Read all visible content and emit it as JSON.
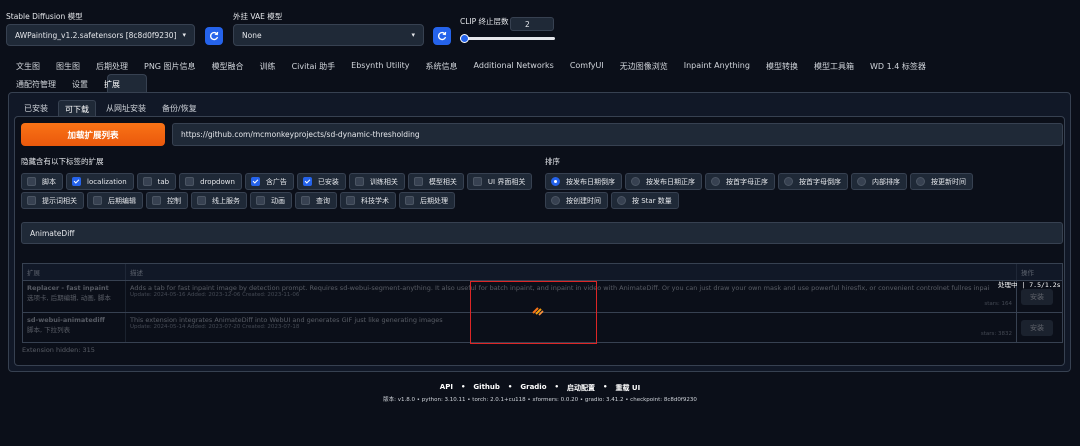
{
  "model": {
    "label": "Stable Diffusion 模型",
    "value": "AWPainting_v1.2.safetensors [8c8d0f9230]"
  },
  "vae": {
    "label": "外挂 VAE 模型",
    "value": "None"
  },
  "clip": {
    "label": "CLIP 终止层数",
    "value": "2",
    "slider_fraction": 0.05
  },
  "nav": {
    "row1": [
      "文生图",
      "图生图",
      "后期处理",
      "PNG 图片信息",
      "模型融合",
      "训练",
      "Civitai 助手",
      "Ebsynth Utility",
      "系统信息",
      "Additional Networks",
      "ComfyUI",
      "无边图像浏览",
      "Inpaint Anything",
      "模型转换",
      "模型工具箱",
      "WD 1.4 标签器"
    ],
    "row2": [
      "通配符管理",
      "设置",
      "扩展"
    ],
    "active": "扩展"
  },
  "subtabs": [
    "已安装",
    "可下载",
    "从网址安装",
    "备份/恢复"
  ],
  "subtab_active": "可下载",
  "load_button": "加载扩展列表",
  "index_url": "https://github.com/mcmonkeyprojects/sd-dynamic-thresholding",
  "hide_label": "隐藏含有以下标签的扩展",
  "tags": [
    {
      "label": "脚本",
      "checked": false
    },
    {
      "label": "localization",
      "checked": true
    },
    {
      "label": "tab",
      "checked": false
    },
    {
      "label": "dropdown",
      "checked": false
    },
    {
      "label": "含广告",
      "checked": true
    },
    {
      "label": "已安装",
      "checked": true
    },
    {
      "label": "训练相关",
      "checked": false
    },
    {
      "label": "模型相关",
      "checked": false
    },
    {
      "label": "UI 界面相关",
      "checked": false
    },
    {
      "label": "提示词相关",
      "checked": false
    },
    {
      "label": "后期编辑",
      "checked": false
    },
    {
      "label": "控制",
      "checked": false
    },
    {
      "label": "线上服务",
      "checked": false
    },
    {
      "label": "动画",
      "checked": false
    },
    {
      "label": "查询",
      "checked": false
    },
    {
      "label": "科技学术",
      "checked": false
    },
    {
      "label": "后期处理",
      "checked": false
    }
  ],
  "sort_label": "排序",
  "sort_options": [
    {
      "label": "按发布日期倒序",
      "checked": true
    },
    {
      "label": "按发布日期正序",
      "checked": false
    },
    {
      "label": "按首字母正序",
      "checked": false
    },
    {
      "label": "按首字母倒序",
      "checked": false
    },
    {
      "label": "内部排序",
      "checked": false
    },
    {
      "label": "按更新时间",
      "checked": false
    },
    {
      "label": "按创建时间",
      "checked": false
    },
    {
      "label": "按 Star 数量",
      "checked": false
    }
  ],
  "search_value": "AnimateDiff",
  "table": {
    "headers": [
      "扩展",
      "描述",
      "操作"
    ],
    "rows": [
      {
        "name": "Replacer - fast inpaint",
        "tags": "选项卡, 后期编辑, 动画, 脚本",
        "desc": "Adds a tab for fast inpaint image by detection prompt. Requires sd-webui-segment-anything. It also useful for batch inpaint, and inpaint in video with AnimateDiff. Or you can just draw your own mask and use powerful hiresfix, or convenient controlnet fullres inpaint",
        "dates": "Update: 2024-05-16 Added: 2023-12-06 Created: 2023-11-06",
        "stars": "stars: 164",
        "action": "安装"
      },
      {
        "name": "sd-webui-animatediff",
        "tags": "脚本, 下拉列表",
        "desc": "This extension integrates AnimateDiff into WebUI and generates GIF just like generating images",
        "dates": "Update: 2024-05-14 Added: 2023-07-20 Created: 2023-07-18",
        "stars": "stars: 3832",
        "action": "安装"
      }
    ]
  },
  "hidden_count": "Extension hidden: 315",
  "progress_text": "处理中 | 7.5/1.2s",
  "footer": {
    "links": [
      "API",
      "Github",
      "Gradio",
      "启动配置",
      "重载 UI"
    ],
    "sep": "•",
    "version": "版本: v1.8.0  •  python: 3.10.11  •  torch: 2.0.1+cu118  •  xformers: 0.0.20  •  gradio: 3.41.2  •  checkpoint: 8c8d0f9230"
  },
  "colors": {
    "accent": "#2563eb",
    "orange": "#f97316",
    "highlight": "#dc2626",
    "background": "#0b0f19"
  }
}
